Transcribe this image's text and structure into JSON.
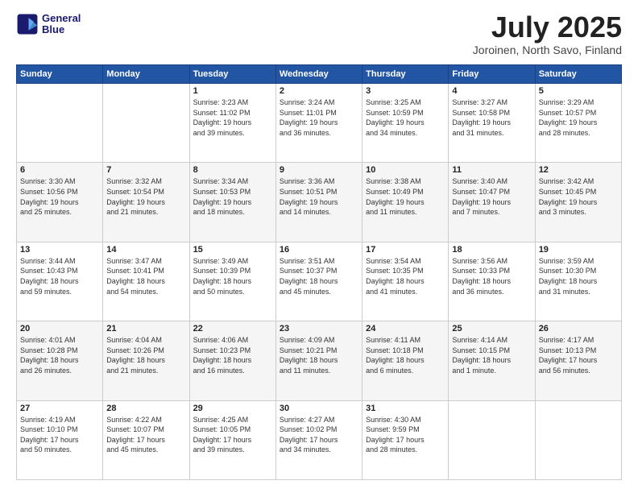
{
  "logo": {
    "line1": "General",
    "line2": "Blue"
  },
  "title": "July 2025",
  "location": "Joroinen, North Savo, Finland",
  "weekdays": [
    "Sunday",
    "Monday",
    "Tuesday",
    "Wednesday",
    "Thursday",
    "Friday",
    "Saturday"
  ],
  "weeks": [
    [
      {
        "day": "",
        "info": ""
      },
      {
        "day": "",
        "info": ""
      },
      {
        "day": "1",
        "info": "Sunrise: 3:23 AM\nSunset: 11:02 PM\nDaylight: 19 hours\nand 39 minutes."
      },
      {
        "day": "2",
        "info": "Sunrise: 3:24 AM\nSunset: 11:01 PM\nDaylight: 19 hours\nand 36 minutes."
      },
      {
        "day": "3",
        "info": "Sunrise: 3:25 AM\nSunset: 10:59 PM\nDaylight: 19 hours\nand 34 minutes."
      },
      {
        "day": "4",
        "info": "Sunrise: 3:27 AM\nSunset: 10:58 PM\nDaylight: 19 hours\nand 31 minutes."
      },
      {
        "day": "5",
        "info": "Sunrise: 3:29 AM\nSunset: 10:57 PM\nDaylight: 19 hours\nand 28 minutes."
      }
    ],
    [
      {
        "day": "6",
        "info": "Sunrise: 3:30 AM\nSunset: 10:56 PM\nDaylight: 19 hours\nand 25 minutes."
      },
      {
        "day": "7",
        "info": "Sunrise: 3:32 AM\nSunset: 10:54 PM\nDaylight: 19 hours\nand 21 minutes."
      },
      {
        "day": "8",
        "info": "Sunrise: 3:34 AM\nSunset: 10:53 PM\nDaylight: 19 hours\nand 18 minutes."
      },
      {
        "day": "9",
        "info": "Sunrise: 3:36 AM\nSunset: 10:51 PM\nDaylight: 19 hours\nand 14 minutes."
      },
      {
        "day": "10",
        "info": "Sunrise: 3:38 AM\nSunset: 10:49 PM\nDaylight: 19 hours\nand 11 minutes."
      },
      {
        "day": "11",
        "info": "Sunrise: 3:40 AM\nSunset: 10:47 PM\nDaylight: 19 hours\nand 7 minutes."
      },
      {
        "day": "12",
        "info": "Sunrise: 3:42 AM\nSunset: 10:45 PM\nDaylight: 19 hours\nand 3 minutes."
      }
    ],
    [
      {
        "day": "13",
        "info": "Sunrise: 3:44 AM\nSunset: 10:43 PM\nDaylight: 18 hours\nand 59 minutes."
      },
      {
        "day": "14",
        "info": "Sunrise: 3:47 AM\nSunset: 10:41 PM\nDaylight: 18 hours\nand 54 minutes."
      },
      {
        "day": "15",
        "info": "Sunrise: 3:49 AM\nSunset: 10:39 PM\nDaylight: 18 hours\nand 50 minutes."
      },
      {
        "day": "16",
        "info": "Sunrise: 3:51 AM\nSunset: 10:37 PM\nDaylight: 18 hours\nand 45 minutes."
      },
      {
        "day": "17",
        "info": "Sunrise: 3:54 AM\nSunset: 10:35 PM\nDaylight: 18 hours\nand 41 minutes."
      },
      {
        "day": "18",
        "info": "Sunrise: 3:56 AM\nSunset: 10:33 PM\nDaylight: 18 hours\nand 36 minutes."
      },
      {
        "day": "19",
        "info": "Sunrise: 3:59 AM\nSunset: 10:30 PM\nDaylight: 18 hours\nand 31 minutes."
      }
    ],
    [
      {
        "day": "20",
        "info": "Sunrise: 4:01 AM\nSunset: 10:28 PM\nDaylight: 18 hours\nand 26 minutes."
      },
      {
        "day": "21",
        "info": "Sunrise: 4:04 AM\nSunset: 10:26 PM\nDaylight: 18 hours\nand 21 minutes."
      },
      {
        "day": "22",
        "info": "Sunrise: 4:06 AM\nSunset: 10:23 PM\nDaylight: 18 hours\nand 16 minutes."
      },
      {
        "day": "23",
        "info": "Sunrise: 4:09 AM\nSunset: 10:21 PM\nDaylight: 18 hours\nand 11 minutes."
      },
      {
        "day": "24",
        "info": "Sunrise: 4:11 AM\nSunset: 10:18 PM\nDaylight: 18 hours\nand 6 minutes."
      },
      {
        "day": "25",
        "info": "Sunrise: 4:14 AM\nSunset: 10:15 PM\nDaylight: 18 hours\nand 1 minute."
      },
      {
        "day": "26",
        "info": "Sunrise: 4:17 AM\nSunset: 10:13 PM\nDaylight: 17 hours\nand 56 minutes."
      }
    ],
    [
      {
        "day": "27",
        "info": "Sunrise: 4:19 AM\nSunset: 10:10 PM\nDaylight: 17 hours\nand 50 minutes."
      },
      {
        "day": "28",
        "info": "Sunrise: 4:22 AM\nSunset: 10:07 PM\nDaylight: 17 hours\nand 45 minutes."
      },
      {
        "day": "29",
        "info": "Sunrise: 4:25 AM\nSunset: 10:05 PM\nDaylight: 17 hours\nand 39 minutes."
      },
      {
        "day": "30",
        "info": "Sunrise: 4:27 AM\nSunset: 10:02 PM\nDaylight: 17 hours\nand 34 minutes."
      },
      {
        "day": "31",
        "info": "Sunrise: 4:30 AM\nSunset: 9:59 PM\nDaylight: 17 hours\nand 28 minutes."
      },
      {
        "day": "",
        "info": ""
      },
      {
        "day": "",
        "info": ""
      }
    ]
  ]
}
